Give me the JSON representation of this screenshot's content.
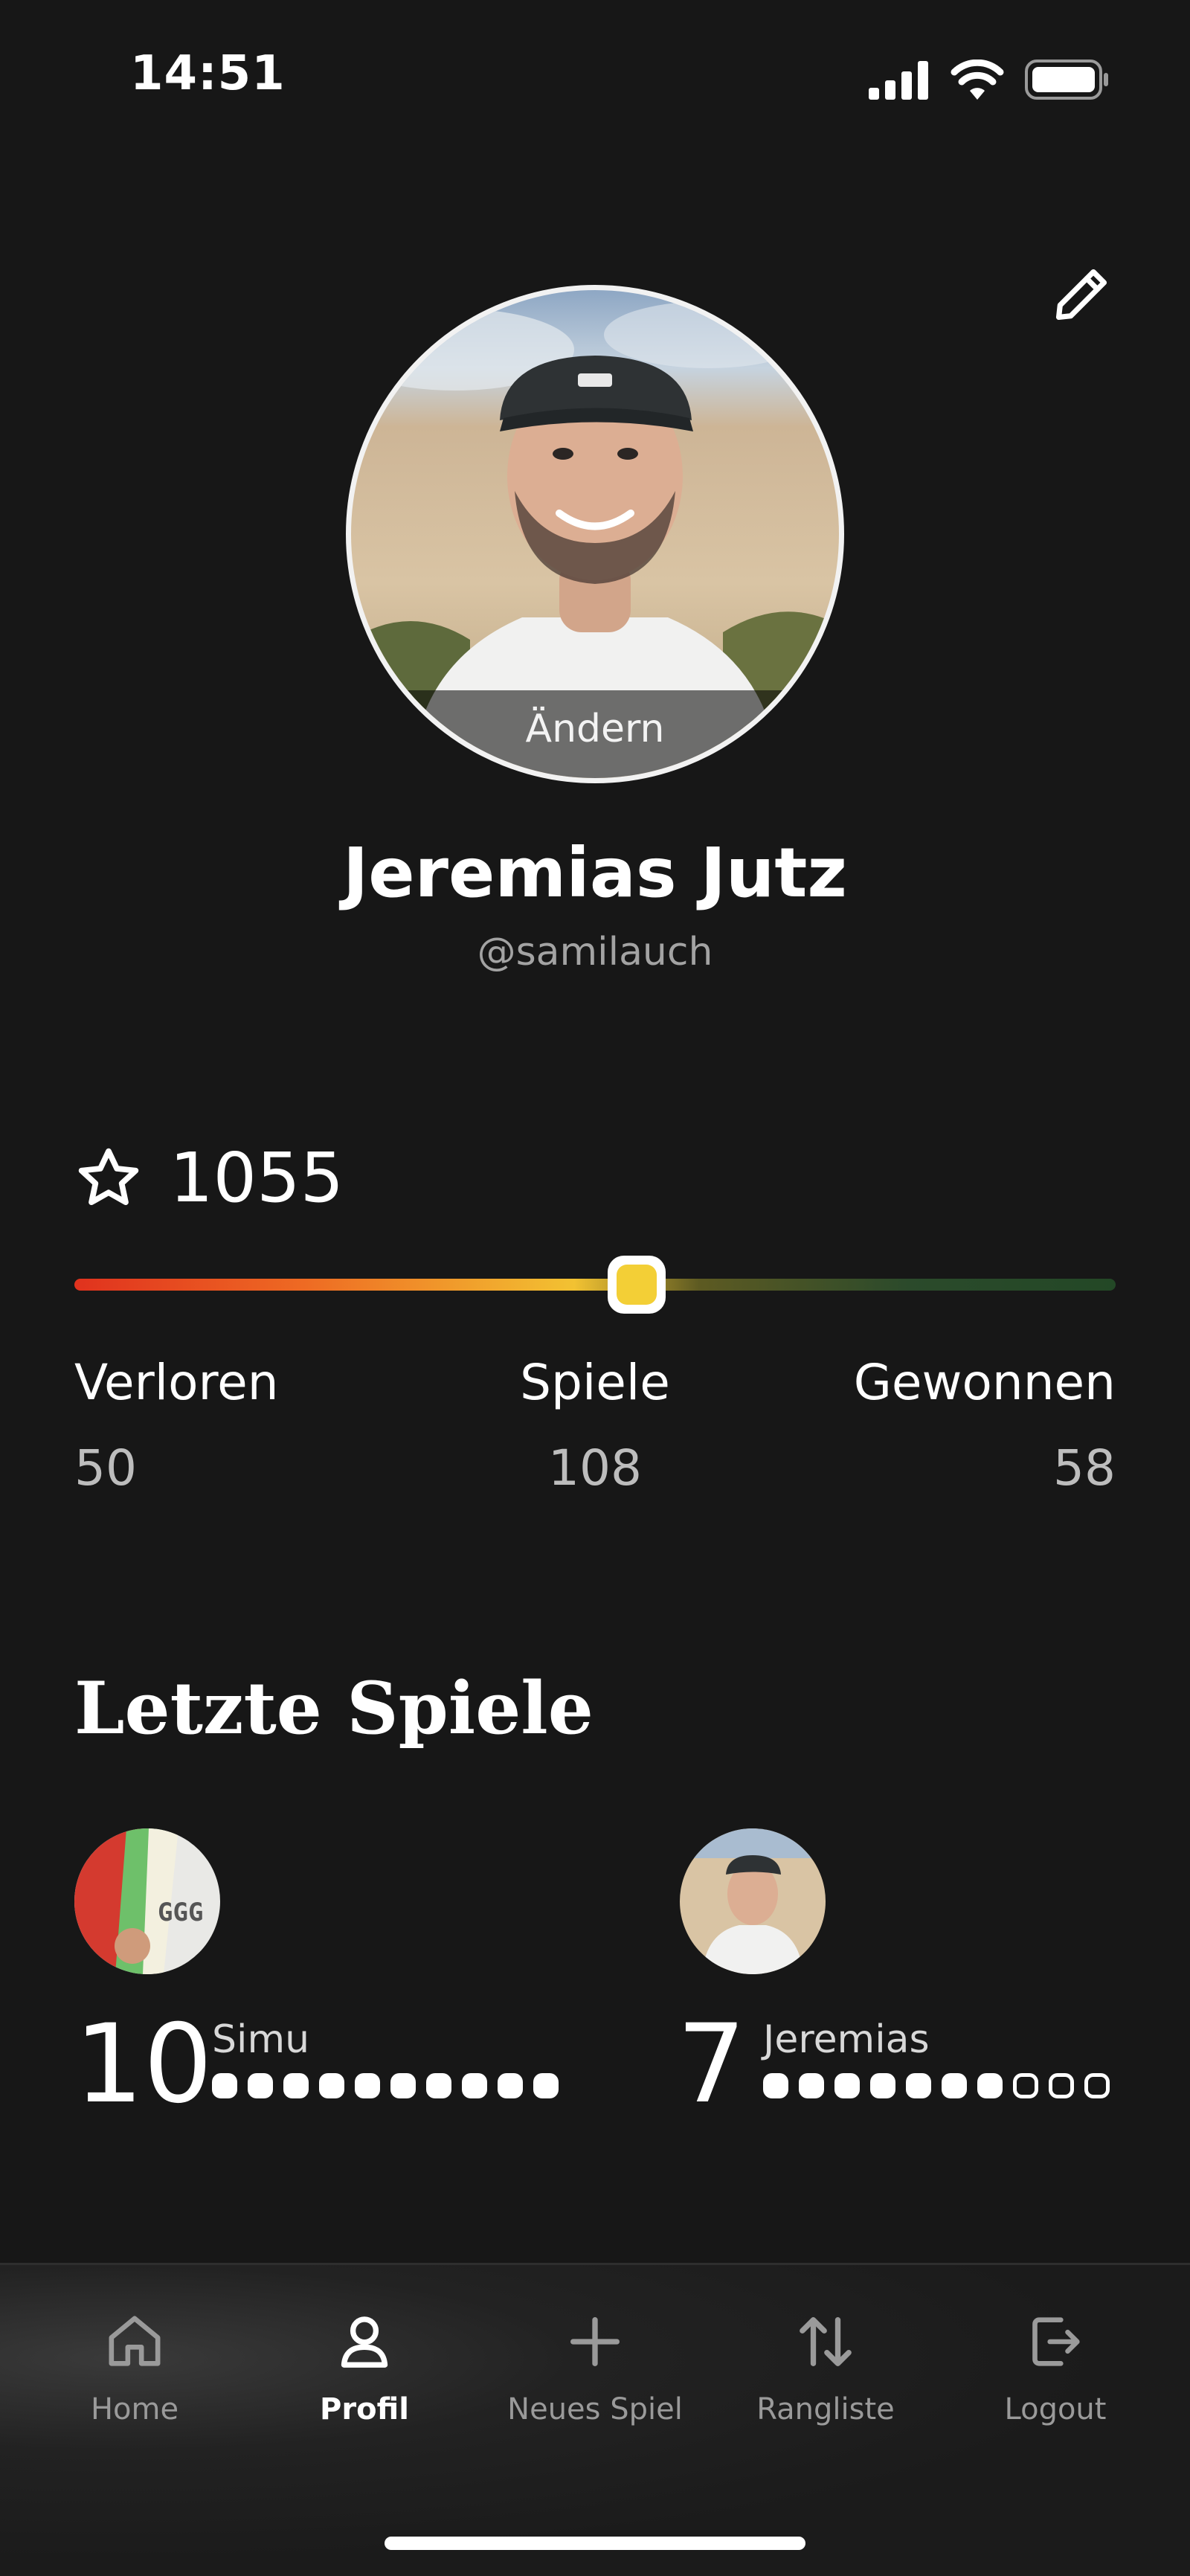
{
  "status_bar": {
    "time": "14:51"
  },
  "profile": {
    "avatar_change_label": "Ändern",
    "name": "Jeremias Jutz",
    "handle": "@samilauch"
  },
  "rating": {
    "value": "1055",
    "position_fraction": 0.54
  },
  "stats": {
    "lost": {
      "label": "Verloren",
      "value": "50"
    },
    "games": {
      "label": "Spiele",
      "value": "108"
    },
    "won": {
      "label": "Gewonnen",
      "value": "58"
    }
  },
  "recent": {
    "title": "Letzte Spiele",
    "players": [
      {
        "name": "Simu",
        "score": "10",
        "filled": 10,
        "total": 10
      },
      {
        "name": "Jeremias",
        "score": "7",
        "filled": 7,
        "total": 10
      }
    ]
  },
  "nav": {
    "items": [
      {
        "label": "Home",
        "icon": "home-icon"
      },
      {
        "label": "Profil",
        "icon": "user-icon",
        "active": true
      },
      {
        "label": "Neues Spiel",
        "icon": "plus-icon"
      },
      {
        "label": "Rangliste",
        "icon": "swap-arrows-icon"
      },
      {
        "label": "Logout",
        "icon": "logout-icon"
      }
    ]
  }
}
